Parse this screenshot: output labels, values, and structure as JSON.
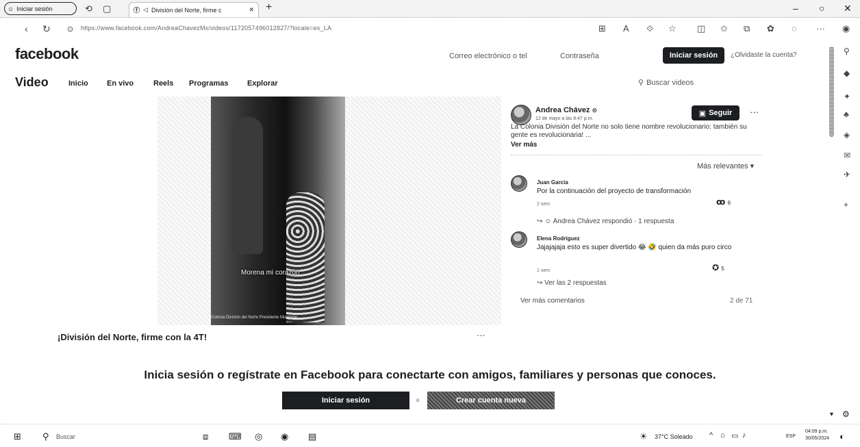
{
  "browser": {
    "profile_label": "Iniciar sesión",
    "tab_title": "División del Norte, firme c",
    "url": "https://www.facebook.com/AndreaChavezMx/videos/1172057496012827/?locale=es_LA"
  },
  "header": {
    "logo": "facebook",
    "email_placeholder": "Correo electrónico o tel",
    "password_placeholder": "Contraseña",
    "login_label": "Iniciar sesión",
    "forgot_label": "¿Olvidaste la cuenta?"
  },
  "video_nav": {
    "title": "Video",
    "items": [
      "Inicio",
      "En vivo",
      "Reels",
      "Programas",
      "Explorar"
    ],
    "search_placeholder": "Buscar videos"
  },
  "video": {
    "caption": "Morena mi corazón",
    "footer": "Colonia División del Norte Presidente Municipio",
    "post_title": "¡División del Norte, firme con la 4T!",
    "more": "···"
  },
  "post": {
    "author": "Andrea Chávez",
    "date": "12 de mayo a las 8:47 p.m.",
    "follow_label": "Seguir",
    "more": "···",
    "text": "La Colonia División del Norte no solo tiene nombre revolucionario: también su gente es revolucionaria! ...",
    "see_more": "Ver más"
  },
  "comments": {
    "sort_label": "Más relevantes",
    "items": [
      {
        "name": "Juan García",
        "text": "Por la continuación del proyecto de transformación",
        "time": "2 sem",
        "reactions": "6",
        "reply": "Andrea Chávez respondió · 1 respuesta"
      },
      {
        "name": "Elena Rodríguez",
        "text": "Jajajajaja esto es super divertido 😂 🤣 quien da más puro circo",
        "time": "1 sem",
        "reactions": "5",
        "reply": "Ver las 2 respuestas"
      }
    ],
    "more_comments": "Ver más comentarios",
    "count": "2 de 71"
  },
  "cta": {
    "title": "Inicia sesión o regístrate en Facebook para conectarte con amigos, familiares y personas que conoces.",
    "login_label": "Iniciar sesión",
    "or": "o",
    "create_label": "Crear cuenta nueva"
  },
  "taskbar": {
    "search_label": "Buscar",
    "weather": "37°C Soleado",
    "lang": "ESP",
    "time": "04:09 p.m.",
    "date": "30/05/2024"
  }
}
